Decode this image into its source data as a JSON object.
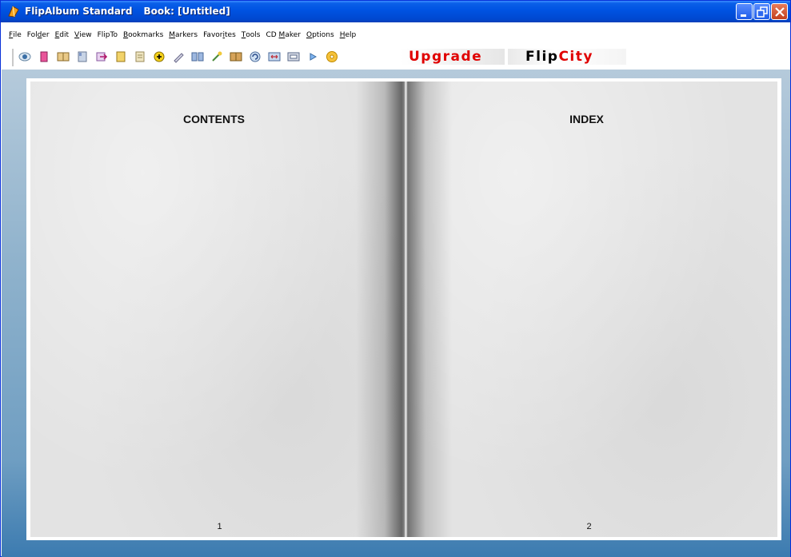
{
  "window": {
    "app_name": "FlipAlbum Standard",
    "book_title": "Book: [Untitled]",
    "controls": [
      "minimize",
      "restore",
      "close"
    ]
  },
  "menu": [
    {
      "label": "File"
    },
    {
      "label": "Folder"
    },
    {
      "label": "Edit"
    },
    {
      "label": "View"
    },
    {
      "label": "FlipTo"
    },
    {
      "label": "Bookmarks"
    },
    {
      "label": "Markers"
    },
    {
      "label": "Favorites"
    },
    {
      "label": "Tools"
    },
    {
      "label": "CD Maker"
    },
    {
      "label": "Options"
    },
    {
      "label": "Help"
    }
  ],
  "toolbar": {
    "icons": [
      "eye-icon",
      "book-pink-icon",
      "open-book-icon",
      "book-icon",
      "import-arrow-icon",
      "page-icon",
      "document-icon",
      "add-plus-icon",
      "pen-icon",
      "two-pages-icon",
      "magic-wand-icon",
      "grid-book-icon",
      "rotate-icon",
      "fit-page-icon",
      "fullscreen-icon",
      "play-icon",
      "cd-icon"
    ],
    "upgrade_label": "Upgrade",
    "flipcity_label_a": "Flip",
    "flipcity_label_b": "City"
  },
  "book": {
    "left_page": {
      "title": "CONTENTS",
      "number": "1"
    },
    "right_page": {
      "title": "INDEX",
      "number": "2"
    }
  }
}
